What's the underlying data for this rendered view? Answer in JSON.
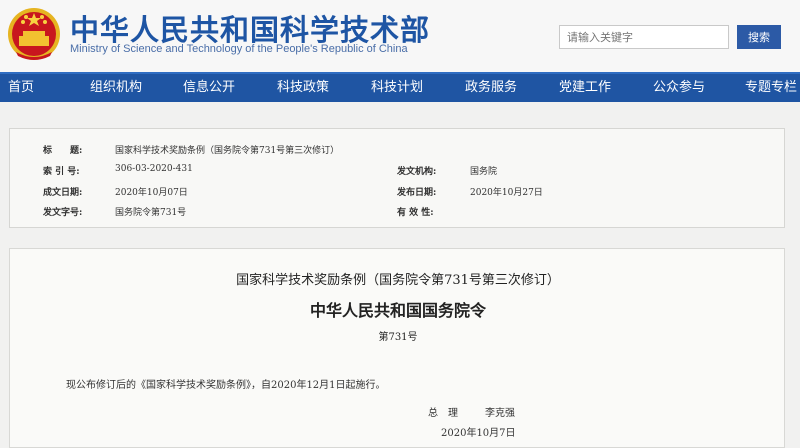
{
  "header": {
    "title": "中华人民共和国科学技术部",
    "subtitle": "Ministry of Science and Technology of the People's Republic of China",
    "emblem_icon": "national-emblem-icon",
    "search": {
      "placeholder": "请输入关键字",
      "button_label": "搜索"
    }
  },
  "nav": {
    "items": [
      {
        "label": "首页"
      },
      {
        "label": "组织机构"
      },
      {
        "label": "信息公开"
      },
      {
        "label": "科技政策"
      },
      {
        "label": "科技计划"
      },
      {
        "label": "政务服务"
      },
      {
        "label": "党建工作"
      },
      {
        "label": "公众参与"
      },
      {
        "label": "专题专栏"
      }
    ]
  },
  "info": {
    "title_label": "标　　题:",
    "title_value": "国家科学技术奖励条例（国务院令第731号第三次修订）",
    "index_label": "索 引 号:",
    "index_value": "306-03-2020-431",
    "issuer_label": "发文机构:",
    "issuer_value": "国务院",
    "written_label": "成文日期:",
    "written_value": "2020年10月07日",
    "published_label": "发布日期:",
    "published_value": "2020年10月27日",
    "docno_label": "发文字号:",
    "docno_value": "国务院令第731号",
    "validity_label": "有 效 性:"
  },
  "document": {
    "heading": "国家科学技术奖励条例（国务院令第731号第三次修订）",
    "subheading": "中华人民共和国国务院令",
    "number": "第731号",
    "body": "现公布修订后的《国家科学技术奖励条例》，自2020年12月1日起施行。",
    "sign_role": "总　理",
    "sign_name": "李克强",
    "sign_date": "2020年10月7日"
  },
  "colors": {
    "brand_blue": "#1e55a4",
    "nav_blue": "#1f55a3",
    "search_button": "#2c5aa6",
    "emblem_red": "#c8161e",
    "emblem_gold": "#f2c230"
  }
}
